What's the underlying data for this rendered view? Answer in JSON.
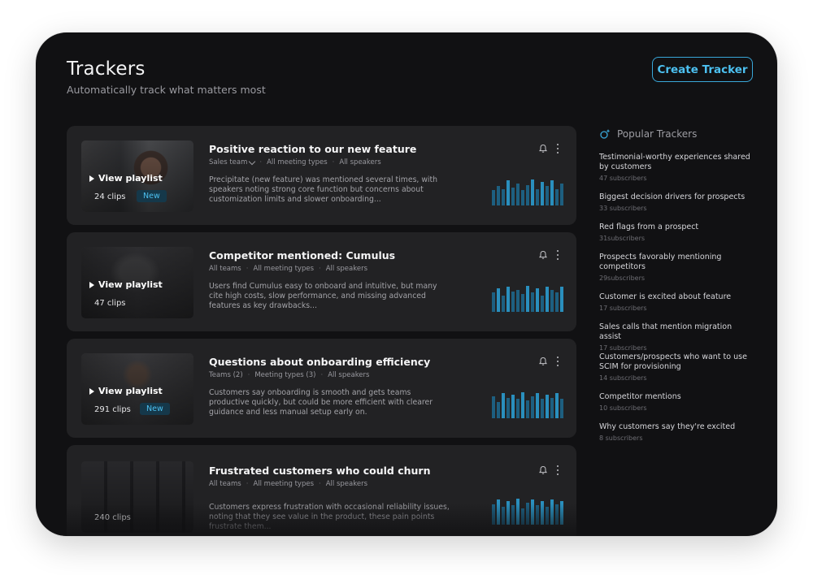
{
  "header": {
    "title": "Trackers",
    "subtitle": "Automatically track what matters most",
    "create_label": "Create Tracker"
  },
  "trackers": [
    {
      "title": "Positive reaction to our new feature",
      "meta": [
        "Sales team",
        "All meeting types",
        "All speakers"
      ],
      "description": "Precipitate (new feature) was mentioned several times, with speakers noting strong core function but concerns about customization limits and slower onboarding...",
      "play_label": "View playlist",
      "clips": "24 clips",
      "badge": "New",
      "activity": [
        0.55,
        0.7,
        0.6,
        0.9,
        0.65,
        0.8,
        0.55,
        0.75,
        0.95,
        0.6,
        0.85,
        0.7,
        0.9,
        0.6,
        0.8
      ]
    },
    {
      "title": "Competitor mentioned: Cumulus",
      "meta": [
        "All teams",
        "All meeting types",
        "All speakers"
      ],
      "description": "Users find Cumulus easy to onboard and intuitive, but many cite high costs, slow performance, and missing advanced features as key drawbacks...",
      "play_label": "View playlist",
      "clips": "47 clips",
      "badge": "",
      "activity": [
        0.7,
        0.85,
        0.6,
        0.9,
        0.75,
        0.8,
        0.65,
        0.95,
        0.7,
        0.85,
        0.6,
        0.9,
        0.8,
        0.7,
        0.9
      ]
    },
    {
      "title": "Questions about onboarding efficiency",
      "meta": [
        "Teams (2)",
        "Meeting types (3)",
        "All speakers"
      ],
      "description": "Customers say onboarding is smooth and gets teams productive quickly, but could be more efficient with clearer guidance and less manual setup early on.",
      "play_label": "View playlist",
      "clips": "291 clips",
      "badge": "New",
      "activity": [
        0.8,
        0.6,
        0.9,
        0.75,
        0.85,
        0.7,
        0.95,
        0.65,
        0.8,
        0.9,
        0.7,
        0.85,
        0.75,
        0.9,
        0.7
      ]
    },
    {
      "title": "Frustrated customers who could churn",
      "meta": [
        "All teams",
        "All meeting types",
        "All speakers"
      ],
      "description": "Customers express frustration with occasional reliability issues, noting that they see value in the product, these pain points frustrate them...",
      "play_label": "",
      "clips": "240 clips",
      "badge": "",
      "activity": [
        0.75,
        0.9,
        0.65,
        0.85,
        0.7,
        0.95,
        0.6,
        0.8,
        0.9,
        0.7,
        0.85,
        0.65,
        0.9,
        0.75,
        0.85
      ]
    }
  ],
  "popular": {
    "title": "Popular Trackers",
    "items": [
      {
        "name": "Testimonial-worthy experiences shared by customers",
        "subs": "47 subscribers"
      },
      {
        "name": "Biggest decision drivers for prospects",
        "subs": "33 subscribers"
      },
      {
        "name": "Red flags from a prospect",
        "subs": "31subscribers"
      },
      {
        "name": "Prospects favorably mentioning competitors",
        "subs": "29subscribers"
      },
      {
        "name": "Customer is excited about feature",
        "subs": "17 subscribers"
      },
      {
        "name": "Sales calls that mention migration assist",
        "subs": "17 subscribers"
      },
      {
        "name": "Customers/prospects who want to use SCIM for provisioning",
        "subs": "14 subscribers"
      },
      {
        "name": "Competitor mentions",
        "subs": "10 subscribers"
      },
      {
        "name": "Why customers say they're excited",
        "subs": "8 subscribers"
      }
    ]
  },
  "colors": {
    "accent": "#4cc0f0",
    "background": "#111113",
    "card": "#222224"
  }
}
